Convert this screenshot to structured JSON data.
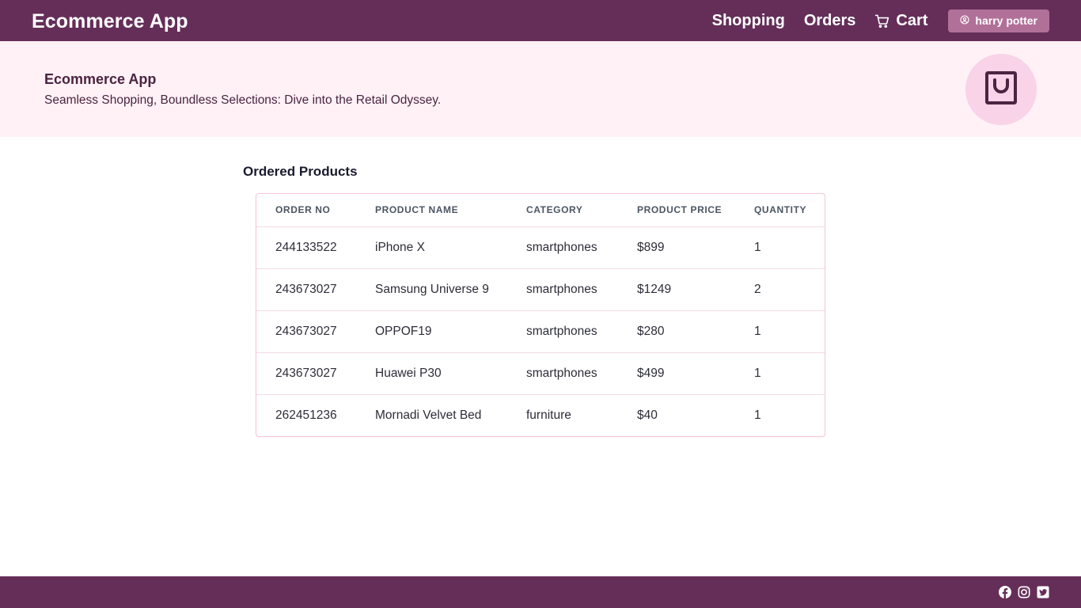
{
  "app": {
    "brand": "Ecommerce App"
  },
  "nav": {
    "shopping": "Shopping",
    "orders": "Orders",
    "cart": "Cart",
    "user": "harry potter"
  },
  "hero": {
    "title": "Ecommerce App",
    "subtitle": "Seamless Shopping, Boundless Selections: Dive into the Retail Odyssey."
  },
  "orders": {
    "title": "Ordered Products",
    "columns": [
      "ORDER NO",
      "PRODUCT NAME",
      "CATEGORY",
      "PRODUCT PRICE",
      "QUANTITY"
    ],
    "rows": [
      [
        "244133522",
        "iPhone X",
        "smartphones",
        "$899",
        "1"
      ],
      [
        "243673027",
        "Samsung Universe 9",
        "smartphones",
        "$1249",
        "2"
      ],
      [
        "243673027",
        "OPPOF19",
        "smartphones",
        "$280",
        "1"
      ],
      [
        "243673027",
        "Huawei P30",
        "smartphones",
        "$499",
        "1"
      ],
      [
        "262451236",
        "Mornadi Velvet Bed",
        "furniture",
        "$40",
        "1"
      ]
    ]
  },
  "icons": {
    "cart": "cart-icon",
    "user": "user-circle-icon",
    "bag": "shopping-bag-icon",
    "facebook": "facebook-icon",
    "instagram": "instagram-icon",
    "twitter": "twitter-icon"
  },
  "colors": {
    "primary": "#652e59",
    "hero_background": "#fff1f6",
    "accent_circle": "#f9d3e8",
    "user_button": "#b07098"
  }
}
